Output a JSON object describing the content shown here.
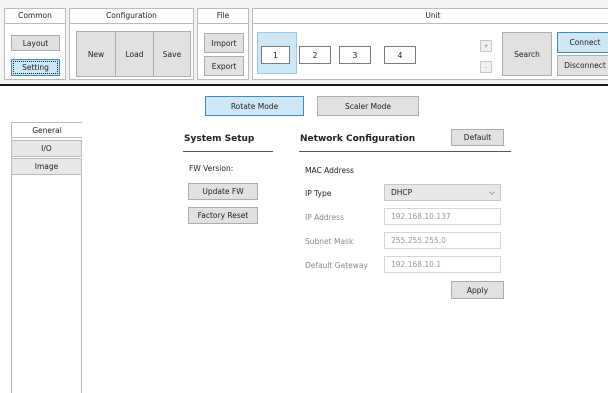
{
  "toolbar": {
    "common": {
      "header": "Common",
      "layout_label": "Layout",
      "setting_label": "Setting"
    },
    "configuration": {
      "header": "Configuration",
      "new_label": "New",
      "load_label": "Load",
      "save_label": "Save"
    },
    "file": {
      "header": "File",
      "import_label": "Import",
      "export_label": "Export"
    },
    "unit": {
      "header": "Unit",
      "units": [
        "1",
        "2",
        "3",
        "4"
      ],
      "plus_label": "+",
      "minus_label": "-",
      "search_label": "Search",
      "connect_label": "Connect",
      "disconnect_label": "Disconnect"
    }
  },
  "mode": {
    "rotate_label": "Rotate Mode",
    "scaler_label": "Scaler Mode"
  },
  "tabs": [
    {
      "label": "General"
    },
    {
      "label": "I/O"
    },
    {
      "label": "Image"
    }
  ],
  "system_setup": {
    "title": "System Setup",
    "fw_version_label": "FW Version:",
    "update_fw_label": "Update FW",
    "factory_reset_label": "Factory Reset"
  },
  "network": {
    "title": "Network Configuration",
    "default_label": "Default",
    "mac_label": "MAC Address",
    "ip_type_label": "IP Type",
    "ip_type_value": "DHCP",
    "ip_address_label": "IP Address",
    "ip_address_value": "192.168.10.137",
    "subnet_label": "Subnet Mask",
    "subnet_value": "255.255.255.0",
    "gateway_label": "Default Gateway",
    "gateway_value": "192.168.10.1",
    "apply_label": "Apply"
  },
  "colors": {
    "accent_selected": "#cde7f7",
    "accent_border": "#3c8cc8",
    "button_face": "#e1e1e1"
  },
  "icons": {
    "dropdown": "chevron-down-icon"
  }
}
